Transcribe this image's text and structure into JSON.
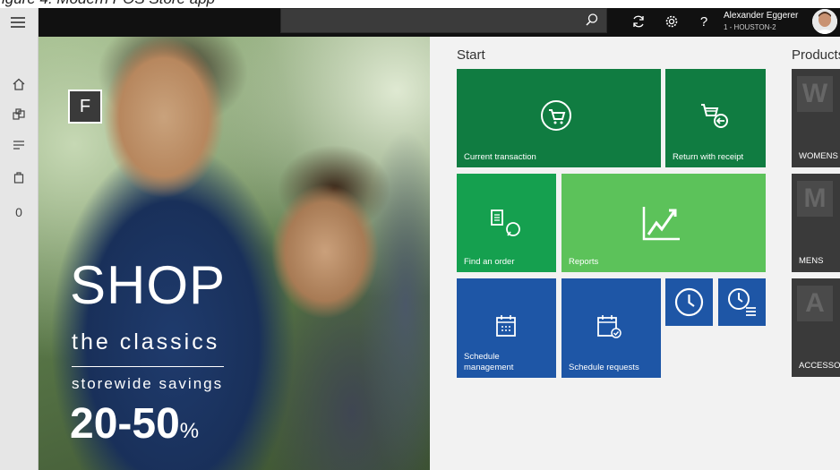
{
  "window_caption": "igure 4. Modern POS Store app",
  "top_bar": {
    "search_placeholder": "",
    "user_name": "Alexander Eggerer",
    "store": "1 - HOUSTON-2",
    "help_label": "?"
  },
  "left_nav": {
    "cart_count": "0"
  },
  "hero": {
    "badge_letter": "F",
    "headline": "SHOP",
    "subheadline": "the classics",
    "tagline": "storewide savings",
    "discount": "20-50",
    "discount_suffix": "%"
  },
  "start": {
    "title": "Start",
    "tiles": {
      "current_transaction": "Current transaction",
      "return_with_receipt": "Return with receipt",
      "find_order": "Find an order",
      "reports": "Reports",
      "schedule_management": "Schedule management",
      "schedule_requests": "Schedule requests"
    }
  },
  "products": {
    "title": "Products",
    "items": [
      {
        "letter": "W",
        "label": "WOMENS"
      },
      {
        "letter": "M",
        "label": "MENS"
      },
      {
        "letter": "A",
        "label": "ACCESSORIES"
      }
    ]
  },
  "colors": {
    "tile_green_dark": "#107c41",
    "tile_green": "#15a04f",
    "tile_green_light": "#5cc25a",
    "tile_blue": "#1e56a6",
    "top_bar": "#111111"
  }
}
